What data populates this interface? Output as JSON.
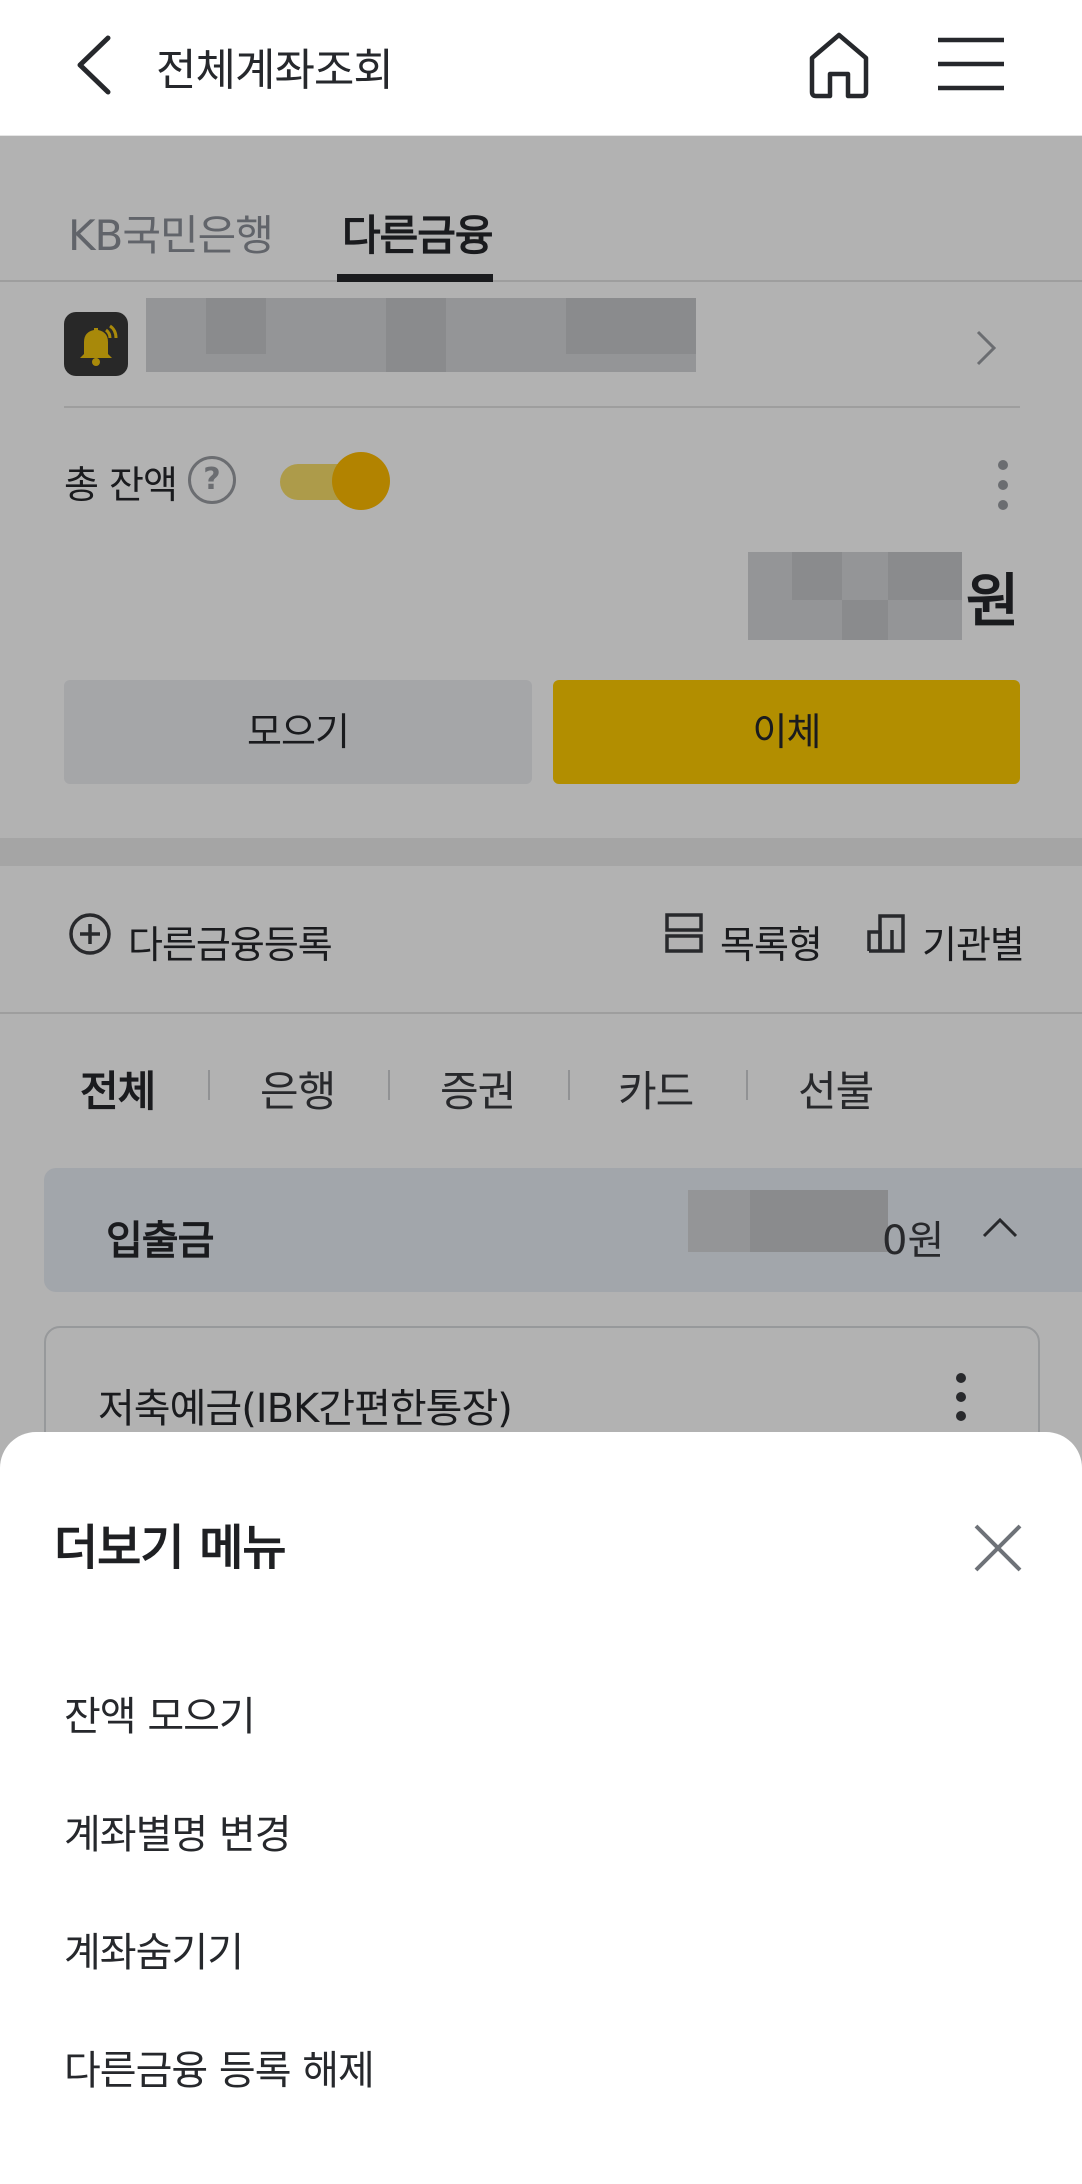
{
  "header": {
    "title": "전체계좌조회",
    "back_icon": "chevron-left-icon",
    "home_icon": "home-icon",
    "menu_icon": "hamburger-menu-icon"
  },
  "tabs": [
    {
      "label": "KB국민은행",
      "active": false
    },
    {
      "label": "다른금융",
      "active": true
    }
  ],
  "alarm": {
    "icon": "bell-icon"
  },
  "balance": {
    "label": "총 잔액",
    "help_icon": "?",
    "toggle_on": true,
    "currency": "원"
  },
  "actions": {
    "collect_label": "모으기",
    "transfer_label": "이체"
  },
  "register_row": {
    "register_label": "다른금융등록",
    "list_view_label": "목록형",
    "by_org_label": "기관별"
  },
  "categories": [
    "전체",
    "은행",
    "증권",
    "카드",
    "선불"
  ],
  "group": {
    "label": "입출금",
    "amount_suffix": "0원"
  },
  "account": {
    "name": "저축예금(IBK간편한통장)"
  },
  "sheet": {
    "title": "더보기 메뉴",
    "items": [
      "잔액 모으기",
      "계좌별명 변경",
      "계좌숨기기",
      "다른금융 등록 해제"
    ]
  },
  "colors": {
    "accent": "#ffcc00",
    "toggle_knob": "#ffbc00",
    "text": "#26282c",
    "group_bg": "#e9eef5"
  }
}
